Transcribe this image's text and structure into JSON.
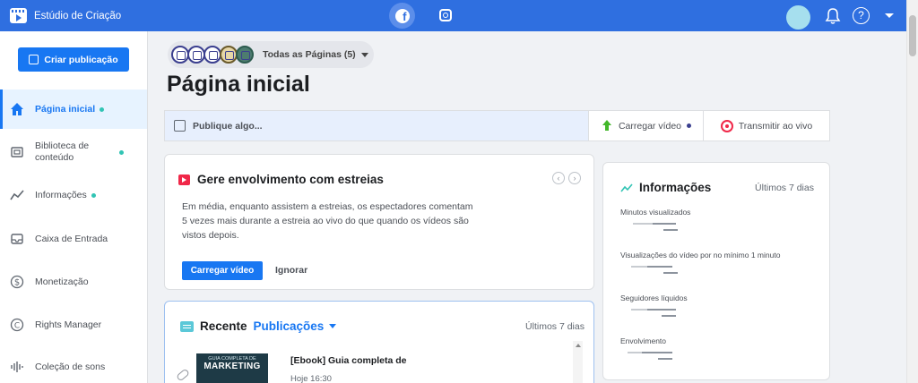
{
  "app": {
    "title": "Estúdio de Criação"
  },
  "colors": {
    "brand": "#2f6fe0",
    "accent": "#1877f2",
    "dot": "#31c4b4"
  },
  "topbar": {
    "icons": [
      "facebook-icon",
      "instagram-icon",
      "bell-icon",
      "help-icon",
      "caret-down-icon"
    ],
    "help_label": "?"
  },
  "sidebar": {
    "create_label": "Criar publicação",
    "items": [
      {
        "label": "Página inicial",
        "icon": "home-icon",
        "active": true,
        "dot": true
      },
      {
        "label": "Biblioteca de conteúdo",
        "icon": "library-icon",
        "active": false,
        "dot": true
      },
      {
        "label": "Informações",
        "icon": "insights-icon",
        "active": false,
        "dot": true
      },
      {
        "label": "Caixa de Entrada",
        "icon": "inbox-icon",
        "active": false,
        "dot": false
      },
      {
        "label": "Monetização",
        "icon": "dollar-icon",
        "active": false,
        "dot": false
      },
      {
        "label": "Rights Manager",
        "icon": "copyright-icon",
        "active": false,
        "dot": false
      },
      {
        "label": "Coleção de sons",
        "icon": "sound-icon",
        "active": false,
        "dot": false
      }
    ]
  },
  "page_selector": {
    "label": "Todas as Páginas (5)"
  },
  "main": {
    "title": "Página inicial"
  },
  "composer": {
    "placeholder": "Publique algo...",
    "upload_label": "Carregar vídeo",
    "live_label": "Transmitir ao vivo"
  },
  "premiere": {
    "title": "Gere envolvimento com estreias",
    "description": "Em média, enquanto assistem a estreias, os espectadores comentam 5 vezes mais durante a estreia ao vivo do que quando os vídeos são vistos depois.",
    "primary_label": "Carregar vídeo",
    "secondary_label": "Ignorar"
  },
  "recent": {
    "title": "Recente",
    "filter": "Publicações",
    "period": "Últimos 7 dias",
    "post": {
      "thumb_small": "GUIA COMPLETA DE",
      "thumb_big": "MARKETING",
      "title": "[Ebook] Guia completa de",
      "time": "Hoje 16:30"
    }
  },
  "insights": {
    "title": "Informações",
    "period": "Últimos 7 dias",
    "metrics": [
      {
        "label": "Minutos visualizados"
      },
      {
        "label": "Visualizações do vídeo por no mínimo 1 minuto"
      },
      {
        "label": "Seguidores líquidos"
      },
      {
        "label": "Envolvimento"
      }
    ]
  }
}
